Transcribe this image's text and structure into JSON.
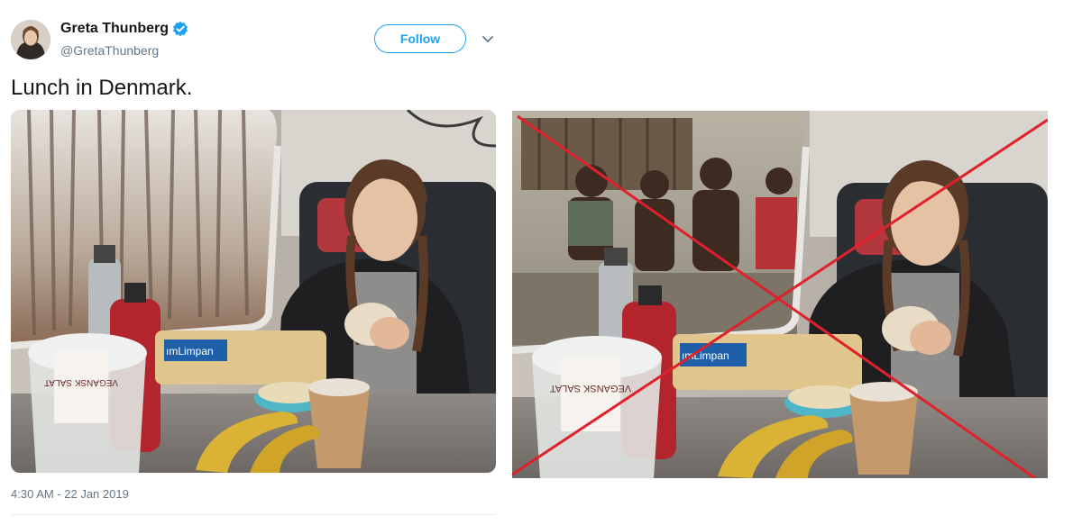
{
  "tweet": {
    "author": {
      "display_name": "Greta Thunberg",
      "handle": "@GretaThunberg",
      "verified": true
    },
    "follow_label": "Follow",
    "text": "Lunch in Denmark.",
    "timestamp": "4:30 AM - 22 Jan 2019",
    "photo_labels": {
      "salad_container": "VEGANSK SALAT",
      "bread_bag": "ımLimpan"
    }
  },
  "edited_image": {
    "photo_labels": {
      "salad_container": "VEGANSK SALAT",
      "bread_bag": "ımLimpan"
    },
    "cross_color": "#e0202a"
  },
  "colors": {
    "accent": "#1da1f2",
    "text_primary": "#14171a",
    "text_secondary": "#657786"
  },
  "icons": {
    "verified": "verified-badge-icon",
    "menu": "chevron-down-icon",
    "cross": "red-x-cross"
  }
}
